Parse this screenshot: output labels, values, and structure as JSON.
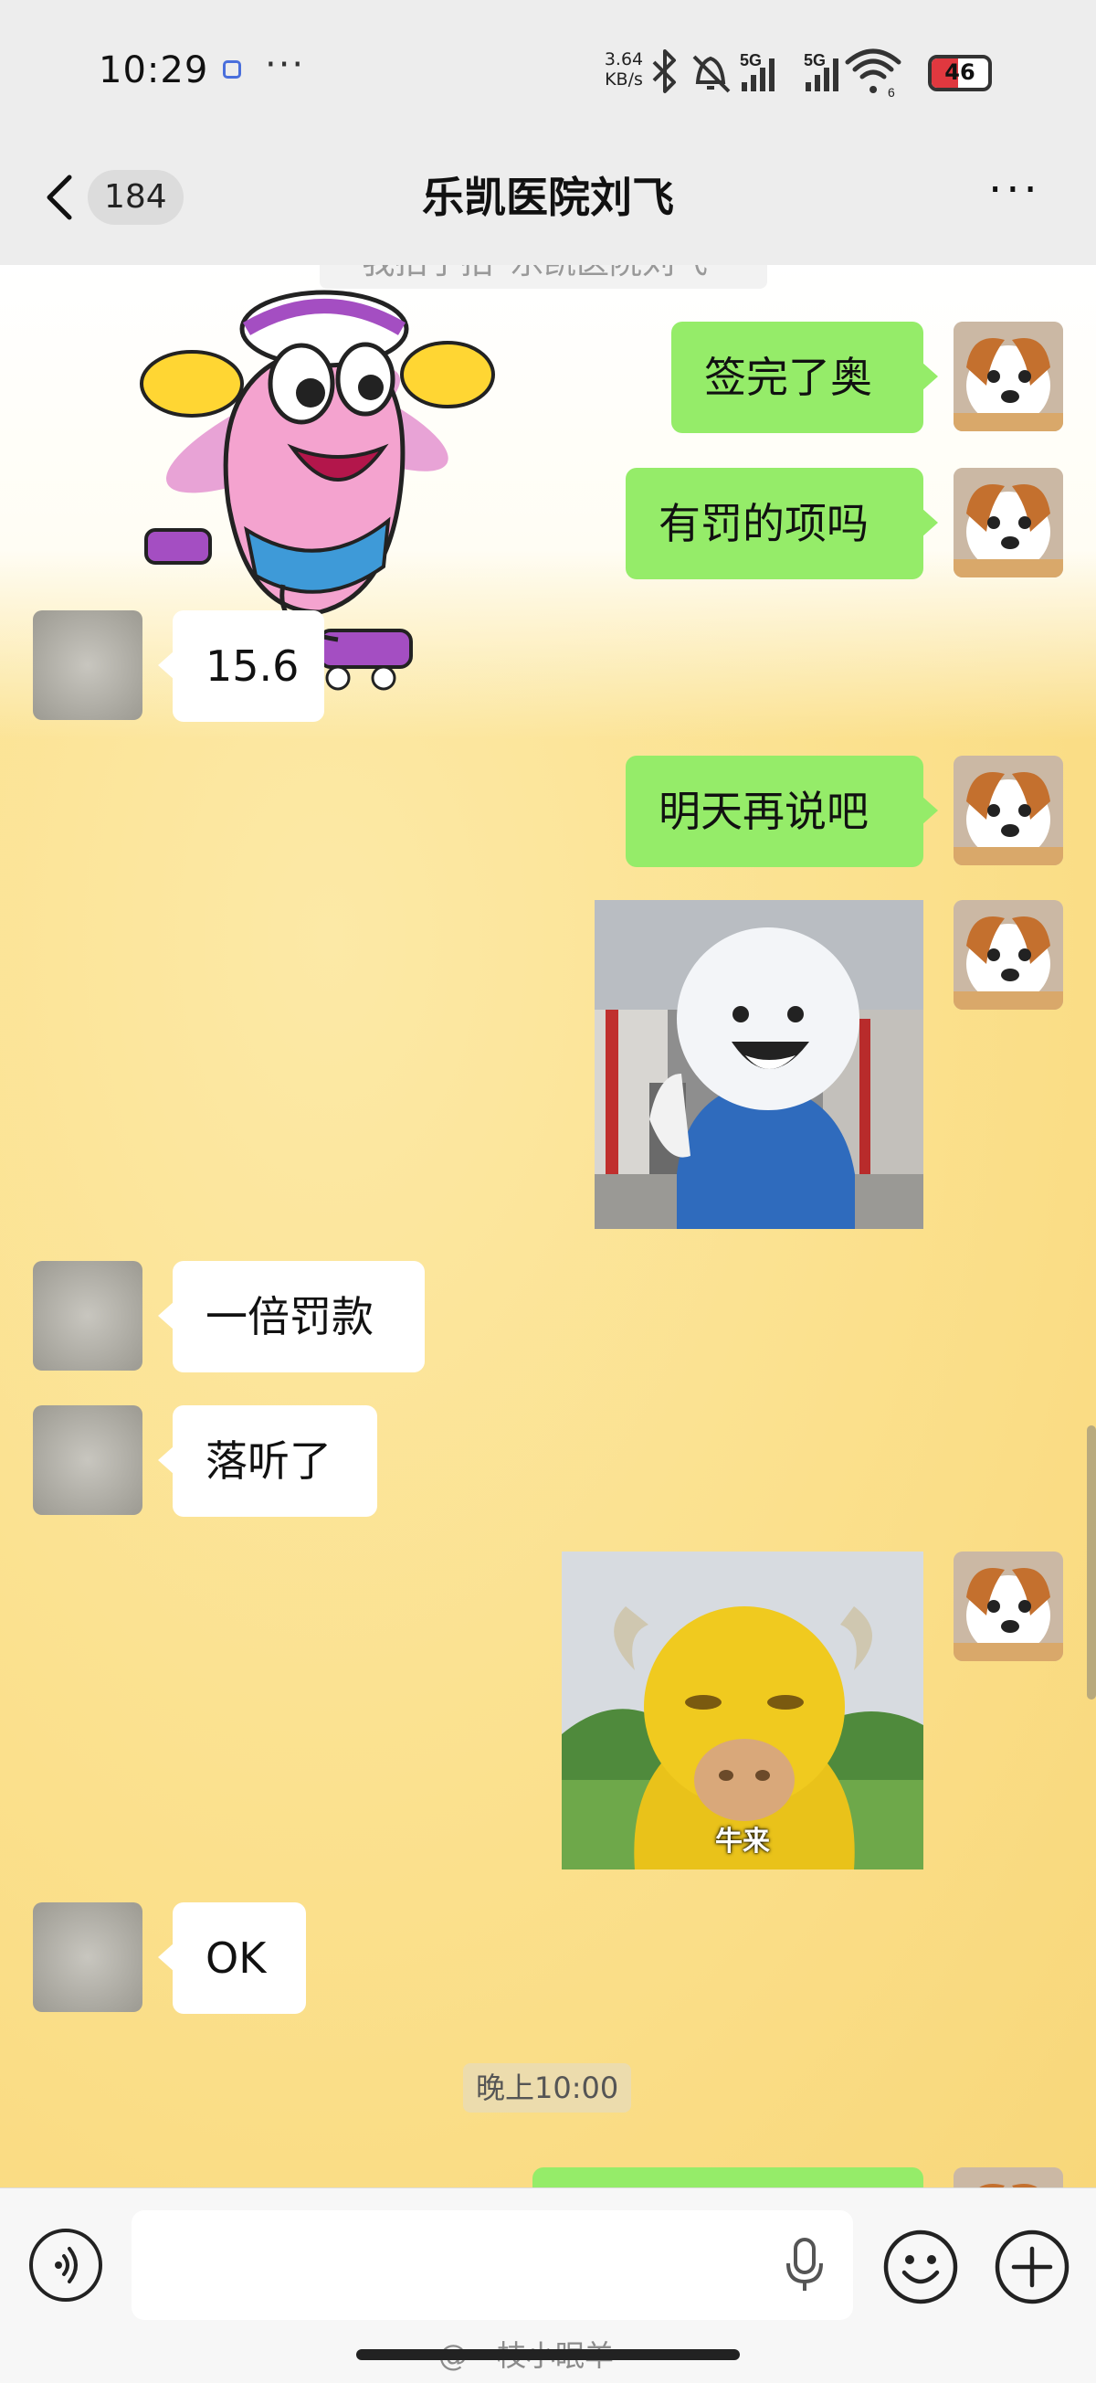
{
  "status_bar": {
    "time": "10:29",
    "app_icon": "app-notification-icon",
    "more": "···",
    "net_speed_value": "3.64",
    "net_speed_unit": "KB/s",
    "sim1_label": "5G",
    "sim2_label": "5G",
    "wifi_sub": "6",
    "battery": "46",
    "battery_level": 0.46,
    "icons": [
      "bluetooth-icon",
      "mute-bell-icon",
      "signal-icon",
      "signal-icon",
      "wifi-icon",
      "battery-icon"
    ]
  },
  "nav": {
    "unread_count": "184",
    "title": "乐凯医院刘飞",
    "more": "···"
  },
  "chat": {
    "system_message": "我拍了拍“乐凯医院刘飞”",
    "messages": [
      {
        "side": "me",
        "type": "text",
        "text": "签完了奥"
      },
      {
        "side": "me",
        "type": "text",
        "text": "有罚的项吗"
      },
      {
        "side": "other",
        "type": "text",
        "text": "15.6"
      },
      {
        "side": "me",
        "type": "text",
        "text": "明天再说吧"
      },
      {
        "side": "me",
        "type": "sticker",
        "sticker": "thumbs-up-mascot-sticker"
      },
      {
        "side": "other",
        "type": "text",
        "text": "一倍罚款"
      },
      {
        "side": "other",
        "type": "text",
        "text": "落听了"
      },
      {
        "side": "me",
        "type": "sticker",
        "sticker": "yellow-bull-sticker",
        "caption": "牛来"
      },
      {
        "side": "other",
        "type": "text",
        "text": "OK"
      }
    ],
    "timestamp": "晚上10:00"
  },
  "input_bar": {
    "voice": "voice-icon",
    "mic": "mic-icon",
    "emoji": "emoji-icon",
    "plus": "plus-icon",
    "watermark": "@一枝小眠羊"
  },
  "colors": {
    "bubble_me": "#95ec69",
    "bubble_other": "#ffffff",
    "chat_bg": "#fbe08c",
    "battery_red": "#e0383f"
  }
}
